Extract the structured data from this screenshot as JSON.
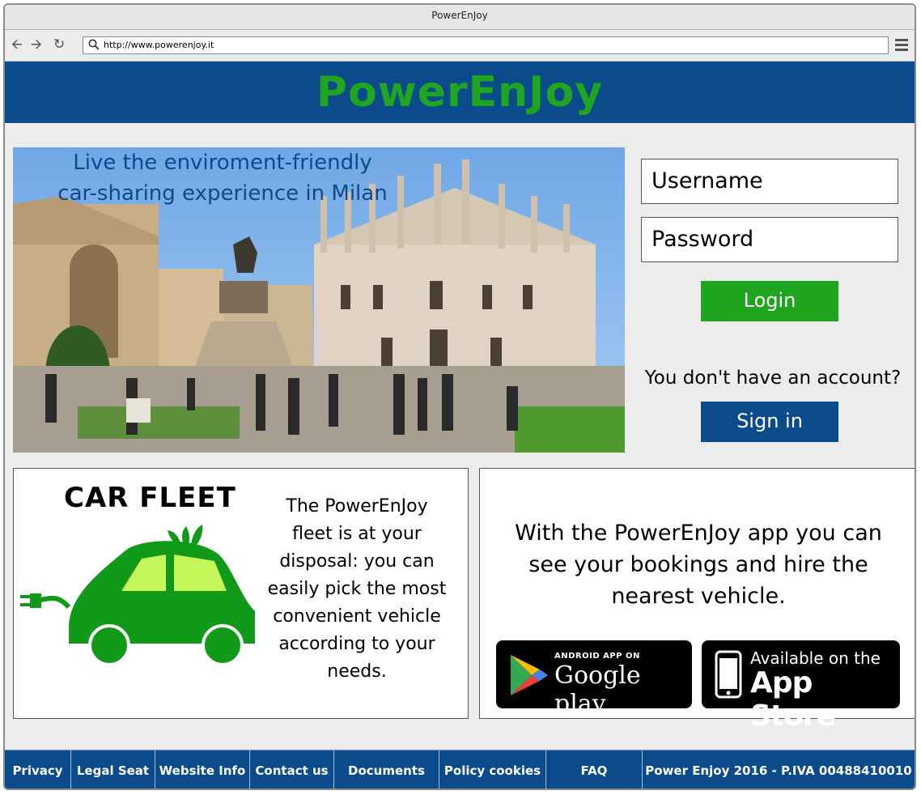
{
  "window": {
    "title": "PowerEnJoy"
  },
  "browser": {
    "url": "http://www.powerenjoy.it"
  },
  "header": {
    "brand": "PowerEnJoy"
  },
  "hero": {
    "tagline_line1": "Live the enviroment-friendly",
    "tagline_line2": "car-sharing experience in Milan"
  },
  "login": {
    "username_placeholder": "Username",
    "password_placeholder": "Password",
    "login_label": "Login",
    "no_account_text": "You don't have an account?",
    "signin_label": "Sign in"
  },
  "fleet": {
    "title": "CAR FLEET",
    "description": "The PowerEnJoy fleet is at your disposal: you can easily pick the most convenient vehicle according to your needs."
  },
  "app": {
    "description": "With the PowerEnJoy app you can see your bookings and hire the nearest vehicle.",
    "google_small": "ANDROID APP ON",
    "google_big": "Google play",
    "apple_small": "Available on the",
    "apple_big": "App Store"
  },
  "footer": {
    "items": [
      "Privacy",
      "Legal Seat",
      "Website Info",
      "Contact us",
      "Documents",
      "Policy cookies",
      "FAQ",
      "Power Enjoy 2016 - P.IVA 00488410010"
    ]
  },
  "colors": {
    "brand_blue": "#0b4b8c",
    "brand_green": "#1fa51f",
    "car_green": "#119a1a",
    "window_light": "#c4f75a"
  },
  "icons": [
    "back-arrow-icon",
    "forward-arrow-icon",
    "refresh-icon",
    "search-icon",
    "menu-icon",
    "electric-car-icon",
    "google-play-icon",
    "apple-phone-icon"
  ]
}
